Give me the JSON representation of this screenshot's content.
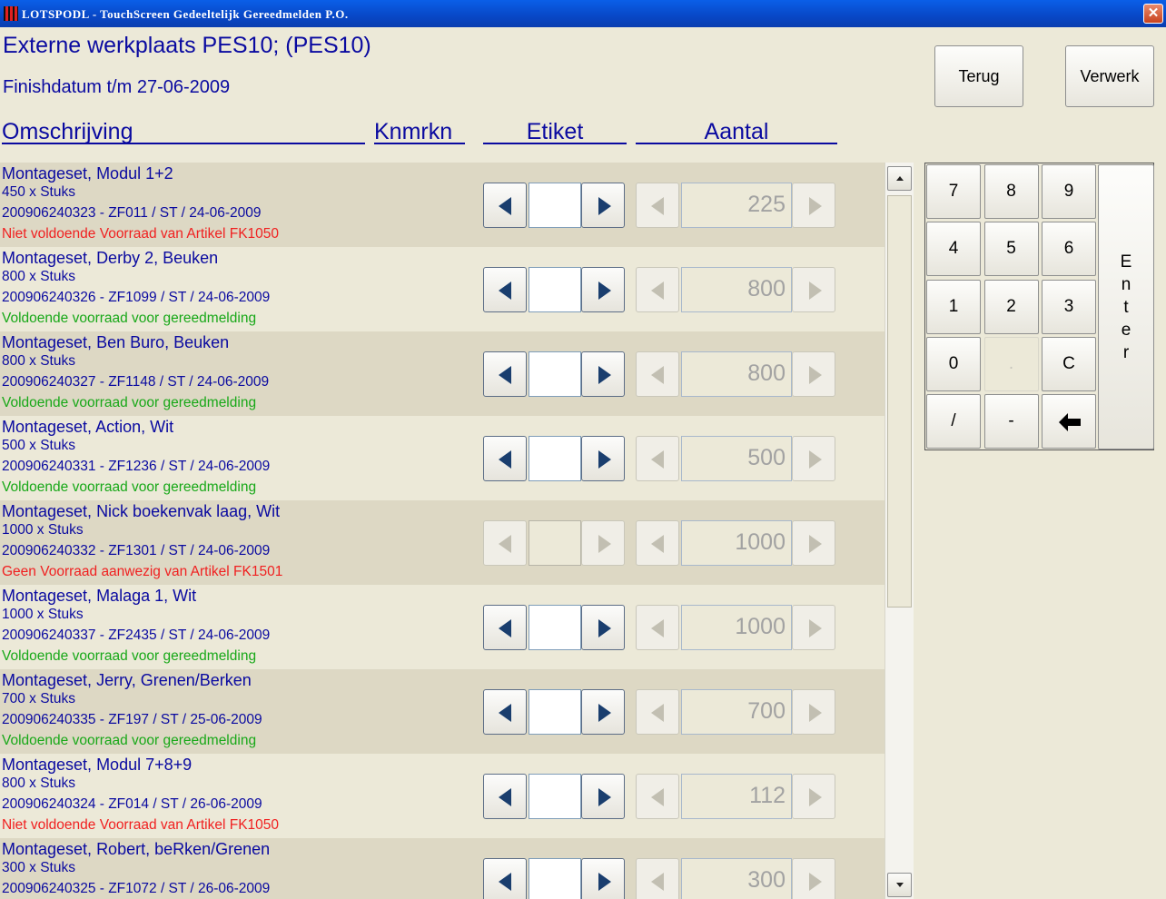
{
  "window": {
    "title": "LOTSPODL - TouchScreen Gedeeltelijk Gereedmelden P.O.",
    "close_label": "✕"
  },
  "header": {
    "title": "Externe werkplaats PES10;  (PES10)",
    "subtitle": "Finishdatum t/m 27-06-2009"
  },
  "buttons": {
    "back": "Terug",
    "process": "Verwerk"
  },
  "columns": {
    "description": "Omschrijving",
    "marks": "Knmrkn",
    "label": "Etiket",
    "quantity": "Aantal"
  },
  "rows": [
    {
      "title": "Montageset, Modul 1+2",
      "qty": "450 x Stuks",
      "ref": "200906240323 - ZF011 / ST / 24-06-2009",
      "status": "Niet voldoende Voorraad van Artikel FK1050",
      "status_type": "red",
      "amount": "225",
      "label_enabled": true
    },
    {
      "title": "Montageset, Derby 2, Beuken",
      "qty": "800 x Stuks",
      "ref": "200906240326 - ZF1099 / ST / 24-06-2009",
      "status": "Voldoende voorraad voor gereedmelding",
      "status_type": "green",
      "amount": "800",
      "label_enabled": true
    },
    {
      "title": "Montageset, Ben Buro, Beuken",
      "qty": "800 x Stuks",
      "ref": "200906240327 - ZF1148 / ST / 24-06-2009",
      "status": "Voldoende voorraad voor gereedmelding",
      "status_type": "green",
      "amount": "800",
      "label_enabled": true
    },
    {
      "title": "Montageset, Action, Wit",
      "qty": "500 x Stuks",
      "ref": "200906240331 - ZF1236 / ST / 24-06-2009",
      "status": "Voldoende voorraad voor gereedmelding",
      "status_type": "green",
      "amount": "500",
      "label_enabled": true
    },
    {
      "title": "Montageset, Nick boekenvak laag, Wit",
      "qty": "1000 x Stuks",
      "ref": "200906240332 - ZF1301 / ST / 24-06-2009",
      "status": "Geen Voorraad aanwezig van Artikel FK1501",
      "status_type": "red",
      "amount": "1000",
      "label_enabled": false
    },
    {
      "title": "Montageset, Malaga 1, Wit",
      "qty": "1000 x Stuks",
      "ref": "200906240337 - ZF2435 / ST / 24-06-2009",
      "status": "Voldoende voorraad voor gereedmelding",
      "status_type": "green",
      "amount": "1000",
      "label_enabled": true
    },
    {
      "title": "Montageset, Jerry, Grenen/Berken",
      "qty": "700 x Stuks",
      "ref": "200906240335 - ZF197 / ST / 25-06-2009",
      "status": "Voldoende voorraad voor gereedmelding",
      "status_type": "green",
      "amount": "700",
      "label_enabled": true
    },
    {
      "title": "Montageset, Modul 7+8+9",
      "qty": "800 x Stuks",
      "ref": "200906240324 - ZF014 / ST / 26-06-2009",
      "status": "Niet voldoende Voorraad van Artikel FK1050",
      "status_type": "red",
      "amount": "112",
      "label_enabled": true
    },
    {
      "title": "Montageset, Robert, beRken/Grenen",
      "qty": "300 x Stuks",
      "ref": "200906240325 - ZF1072 / ST / 26-06-2009",
      "status": "",
      "status_type": "green",
      "amount": "300",
      "label_enabled": true
    }
  ],
  "keypad": {
    "keys": [
      "7",
      "8",
      "9",
      "4",
      "5",
      "6",
      "1",
      "2",
      "3",
      "0",
      ".",
      "C",
      "/",
      "-"
    ],
    "enter": "Enter",
    "backspace_icon": "arrow-left-icon"
  },
  "colors": {
    "accent_text": "#0A0AA0",
    "status_red": "#F02020",
    "status_green": "#18A818",
    "row_alt": "#DDD8C4",
    "titlebar": "#0A5FE8"
  }
}
